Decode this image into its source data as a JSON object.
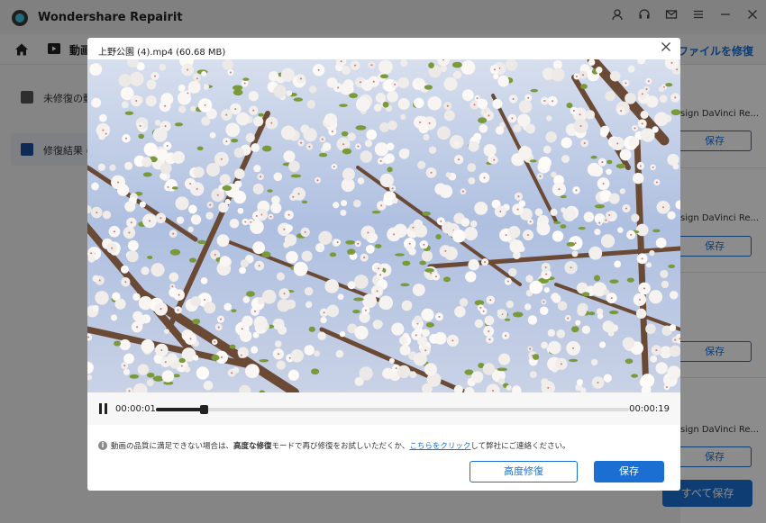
{
  "app": {
    "title": "Wondershare Repairit"
  },
  "navbar": {
    "video_label": "動画",
    "right_link": "ファイルを修復"
  },
  "sidebar": {
    "items": [
      {
        "label": "未修復の動"
      },
      {
        "label": "修復結果 ("
      }
    ]
  },
  "file_list": {
    "items": [
      {
        "text": "sign DaVinci Re...",
        "save_label": "保存"
      },
      {
        "text": "sign DaVinci Re...",
        "save_label": "保存"
      },
      {
        "text": "",
        "save_label": "保存"
      },
      {
        "text": "sign DaVinci Re...",
        "save_label": "保存"
      }
    ],
    "save_all_label": "すべて保存"
  },
  "preview": {
    "title": "上野公園 (4).mp4 (60.68  MB)",
    "current_time": "00:00:01",
    "total_time": "00:00:19",
    "progress": 0.1,
    "notice_part1": "動画の品質に満足できない場合は、",
    "notice_bold": "高度な修復",
    "notice_part2": "モードで再び修復をお試しいただくか、",
    "notice_link": "こちらをクリック",
    "notice_part3": "して弊社にご連絡ください。",
    "advanced_button": "高度修復",
    "save_button": "保存"
  },
  "colors": {
    "accent": "#1b6fd2",
    "overlay": "rgba(0,0,0,0.45)"
  }
}
